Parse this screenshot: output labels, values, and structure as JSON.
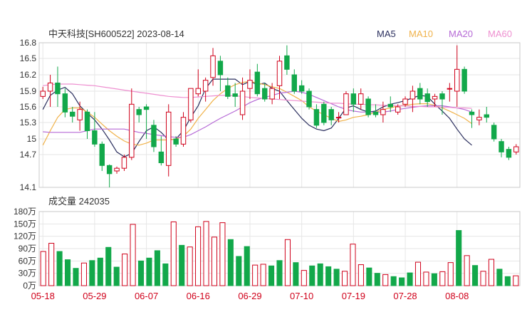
{
  "header": {
    "title": "中天科技[SH600522] 2023-08-14"
  },
  "legend": [
    {
      "label": "MA5",
      "color": "#2b2f5e"
    },
    {
      "label": "MA10",
      "color": "#f0b24a"
    },
    {
      "label": "MA20",
      "color": "#b66ad6"
    },
    {
      "label": "MA60",
      "color": "#ee8fd0"
    }
  ],
  "colors": {
    "up": "#d0021b",
    "down": "#12a84a",
    "grid": "#e6e6e6"
  },
  "chart_data": [
    {
      "type": "candlestick",
      "title": "中天科技[SH600522] 2023-08-14",
      "ylim": [
        14.1,
        16.8
      ],
      "yticks": [
        16.8,
        16.5,
        16.2,
        15.9,
        15.6,
        15.3,
        15,
        14.7,
        14.1
      ],
      "ytick_labels": [
        "16.8",
        "16.5",
        "16.2",
        "15.9",
        "15.6",
        "15.3",
        "15",
        "14.7",
        "14.1"
      ],
      "x_tick_labels": [
        {
          "index": 0,
          "label": "05-18"
        },
        {
          "index": 7,
          "label": "05-29"
        },
        {
          "index": 14,
          "label": "06-07"
        },
        {
          "index": 21,
          "label": "06-16"
        },
        {
          "index": 28,
          "label": "06-29"
        },
        {
          "index": 35,
          "label": "07-10"
        },
        {
          "index": 42,
          "label": "07-19"
        },
        {
          "index": 49,
          "label": "07-28"
        },
        {
          "index": 56,
          "label": "08-08"
        }
      ],
      "series": [
        {
          "name": "MA5",
          "values": [
            15.55,
            15.82,
            15.92,
            15.97,
            15.85,
            15.62,
            15.48,
            15.35,
            15.18,
            14.98,
            14.75,
            14.66,
            14.72,
            14.95,
            15.15,
            15.22,
            15.12,
            14.98,
            15.0,
            15.15,
            15.4,
            15.62,
            15.95,
            16.12,
            16.12,
            16.12,
            16.12,
            16.02,
            16.08,
            16.02,
            16.05,
            15.95,
            15.9,
            15.72,
            15.55,
            15.38,
            15.25,
            15.18,
            15.15,
            15.2,
            15.38,
            15.58,
            15.62,
            15.55,
            15.5,
            15.52,
            15.6,
            15.65,
            15.68,
            15.72,
            15.77,
            15.82,
            15.8,
            15.65,
            15.52,
            15.38,
            15.18,
            15.0,
            14.88
          ]
        },
        {
          "name": "MA10",
          "values": [
            14.88,
            15.15,
            15.4,
            15.55,
            15.58,
            15.58,
            15.5,
            15.4,
            15.27,
            15.15,
            15.05,
            14.96,
            14.9,
            14.88,
            14.92,
            14.98,
            14.98,
            14.98,
            15.0,
            15.05,
            15.18,
            15.38,
            15.55,
            15.72,
            15.85,
            15.95,
            16.02,
            16.06,
            16.08,
            16.05,
            16.02,
            15.98,
            15.95,
            15.88,
            15.8,
            15.72,
            15.6,
            15.52,
            15.45,
            15.38,
            15.32,
            15.35,
            15.4,
            15.42,
            15.45,
            15.5,
            15.55,
            15.58,
            15.62,
            15.63,
            15.65,
            15.66,
            15.66,
            15.63,
            15.58,
            15.52,
            15.45,
            15.38,
            15.28
          ]
        },
        {
          "name": "MA20",
          "values": [
            15.13,
            15.12,
            15.12,
            15.12,
            15.12,
            15.12,
            15.15,
            15.18,
            15.18,
            15.18,
            15.18,
            15.18,
            15.15,
            15.12,
            15.1,
            15.08,
            15.06,
            15.04,
            15.03,
            15.03,
            15.08,
            15.15,
            15.22,
            15.3,
            15.38,
            15.45,
            15.52,
            15.6,
            15.68,
            15.74,
            15.78,
            15.82,
            15.86,
            15.88,
            15.9,
            15.88,
            15.84,
            15.78,
            15.72,
            15.66,
            15.6,
            15.55,
            15.52,
            15.5,
            15.5,
            15.5,
            15.5,
            15.52,
            15.55,
            15.57,
            15.59,
            15.61,
            15.62,
            15.62,
            15.62,
            15.6,
            15.58,
            15.55,
            15.5
          ]
        },
        {
          "name": "MA60",
          "values": [
            16.0,
            16.02,
            16.03,
            16.03,
            16.03,
            16.02,
            16.01,
            16.0,
            15.98,
            15.96,
            15.94,
            15.92,
            15.9,
            15.88,
            15.86,
            15.84,
            15.82,
            15.8,
            15.79,
            15.78,
            15.78,
            15.79,
            15.8,
            15.81,
            15.82,
            15.82,
            15.81,
            15.8,
            15.78,
            15.77,
            15.76,
            15.75,
            15.74,
            15.73,
            15.72,
            15.71,
            15.7,
            15.69,
            15.68,
            15.67,
            15.67,
            15.66,
            15.65,
            15.65,
            15.64,
            15.64,
            15.63,
            15.63,
            15.62,
            15.62,
            15.61,
            15.61,
            15.6,
            15.6,
            15.59,
            15.59,
            15.58,
            15.58,
            15.57
          ]
        }
      ],
      "candles": [
        [
          15.8,
          15.9,
          15.75,
          15.98
        ],
        [
          15.9,
          16.05,
          15.6,
          16.2
        ],
        [
          16.05,
          15.85,
          15.6,
          16.35
        ],
        [
          15.85,
          15.5,
          15.4,
          15.95
        ],
        [
          15.5,
          15.42,
          15.3,
          15.6
        ],
        [
          15.35,
          15.55,
          15.15,
          15.7
        ],
        [
          15.5,
          15.15,
          15.0,
          15.55
        ],
        [
          15.15,
          14.9,
          14.85,
          15.5
        ],
        [
          14.9,
          14.5,
          14.4,
          14.95
        ],
        [
          14.5,
          14.35,
          14.1,
          14.52
        ],
        [
          14.4,
          14.45,
          14.35,
          14.48
        ],
        [
          14.45,
          14.65,
          14.4,
          14.7
        ],
        [
          14.65,
          15.65,
          14.6,
          15.95
        ],
        [
          15.55,
          15.45,
          15.3,
          15.6
        ],
        [
          15.6,
          15.55,
          15.0,
          15.65
        ],
        [
          15.25,
          14.85,
          14.75,
          15.35
        ],
        [
          14.75,
          14.55,
          14.5,
          15.05
        ],
        [
          14.5,
          15.5,
          14.3,
          15.65
        ],
        [
          15.0,
          14.9,
          14.85,
          15.05
        ],
        [
          14.9,
          15.4,
          14.85,
          15.5
        ],
        [
          15.35,
          15.95,
          15.3,
          15.95
        ],
        [
          15.85,
          15.95,
          15.8,
          16.3
        ],
        [
          15.9,
          16.1,
          15.7,
          16.15
        ],
        [
          16.15,
          16.55,
          16.0,
          16.7
        ],
        [
          16.45,
          16.2,
          15.9,
          16.55
        ],
        [
          16.0,
          15.8,
          15.75,
          16.15
        ],
        [
          15.85,
          15.8,
          15.6,
          16.05
        ],
        [
          15.45,
          15.9,
          15.35,
          16.15
        ],
        [
          15.95,
          16.1,
          15.75,
          16.3
        ],
        [
          16.25,
          15.85,
          15.8,
          16.4
        ],
        [
          15.95,
          15.75,
          15.7,
          16.05
        ],
        [
          15.75,
          15.95,
          15.65,
          16.05
        ],
        [
          16.0,
          16.45,
          15.75,
          16.55
        ],
        [
          16.55,
          16.3,
          16.2,
          16.75
        ],
        [
          16.2,
          15.9,
          15.85,
          16.3
        ],
        [
          16.0,
          15.9,
          15.85,
          16.1
        ],
        [
          15.9,
          15.6,
          15.55,
          15.95
        ],
        [
          15.55,
          15.25,
          15.2,
          15.65
        ],
        [
          15.65,
          15.3,
          15.25,
          15.7
        ],
        [
          15.55,
          15.35,
          15.25,
          15.6
        ],
        [
          15.4,
          15.4,
          15.3,
          15.5
        ],
        [
          15.45,
          15.85,
          15.45,
          15.9
        ],
        [
          15.85,
          15.65,
          15.5,
          15.95
        ],
        [
          15.65,
          15.85,
          15.55,
          15.95
        ],
        [
          15.75,
          15.45,
          15.4,
          15.8
        ],
        [
          15.5,
          15.45,
          15.4,
          15.65
        ],
        [
          15.45,
          15.55,
          15.3,
          15.7
        ],
        [
          15.65,
          15.6,
          15.5,
          15.8
        ],
        [
          15.5,
          15.6,
          15.45,
          15.65
        ],
        [
          15.65,
          15.75,
          15.6,
          15.8
        ],
        [
          15.75,
          15.9,
          15.5,
          16.0
        ],
        [
          15.95,
          15.75,
          15.65,
          16.05
        ],
        [
          15.85,
          15.7,
          15.6,
          15.95
        ],
        [
          15.75,
          15.8,
          15.6,
          15.85
        ],
        [
          15.85,
          15.75,
          15.45,
          15.9
        ],
        [
          15.95,
          15.95,
          15.7,
          16.05
        ],
        [
          15.9,
          16.3,
          15.6,
          16.75
        ],
        [
          16.3,
          15.9,
          15.85,
          16.35
        ],
        [
          15.5,
          15.45,
          15.2,
          15.55
        ],
        [
          15.35,
          15.4,
          15.25,
          15.55
        ],
        [
          15.45,
          15.4,
          15.3,
          15.6
        ],
        [
          15.25,
          15.0,
          14.95,
          15.3
        ],
        [
          14.95,
          14.75,
          14.65,
          15.0
        ],
        [
          14.8,
          14.65,
          14.6,
          14.85
        ],
        [
          14.75,
          14.85,
          14.7,
          14.9
        ]
      ],
      "candles_note": "[open, close, low, high] per trading day"
    },
    {
      "type": "bar",
      "title": "成交量 242035",
      "ylim": [
        0,
        180
      ],
      "yticks": [
        180,
        150,
        120,
        90,
        60,
        30,
        0
      ],
      "ytick_labels": [
        "180万",
        "150万",
        "120万",
        "90万",
        "60万",
        "30万",
        "0万"
      ],
      "unit": "万",
      "volumes": [
        83,
        103,
        83,
        63,
        42,
        55,
        61,
        67,
        93,
        45,
        77,
        149,
        60,
        67,
        85,
        53,
        155,
        98,
        94,
        143,
        156,
        118,
        153,
        112,
        71,
        95,
        50,
        52,
        48,
        61,
        112,
        56,
        37,
        48,
        53,
        46,
        40,
        35,
        101,
        51,
        43,
        30,
        27,
        22,
        19,
        31,
        57,
        33,
        29,
        34,
        56,
        134,
        73,
        49,
        35,
        64,
        40,
        22,
        24
      ],
      "up_down": [
        1,
        1,
        0,
        0,
        0,
        1,
        0,
        0,
        0,
        0,
        1,
        1,
        0,
        0,
        0,
        0,
        1,
        0,
        1,
        1,
        1,
        1,
        1,
        0,
        0,
        0,
        1,
        1,
        0,
        0,
        1,
        0,
        1,
        0,
        0,
        0,
        0,
        1,
        1,
        1,
        0,
        0,
        1,
        0,
        0,
        0,
        1,
        1,
        0,
        1,
        1,
        0,
        1,
        0,
        1,
        1,
        0,
        0,
        1
      ],
      "colors": {
        "up": "#d0021b",
        "down": "#12a84a"
      }
    }
  ]
}
